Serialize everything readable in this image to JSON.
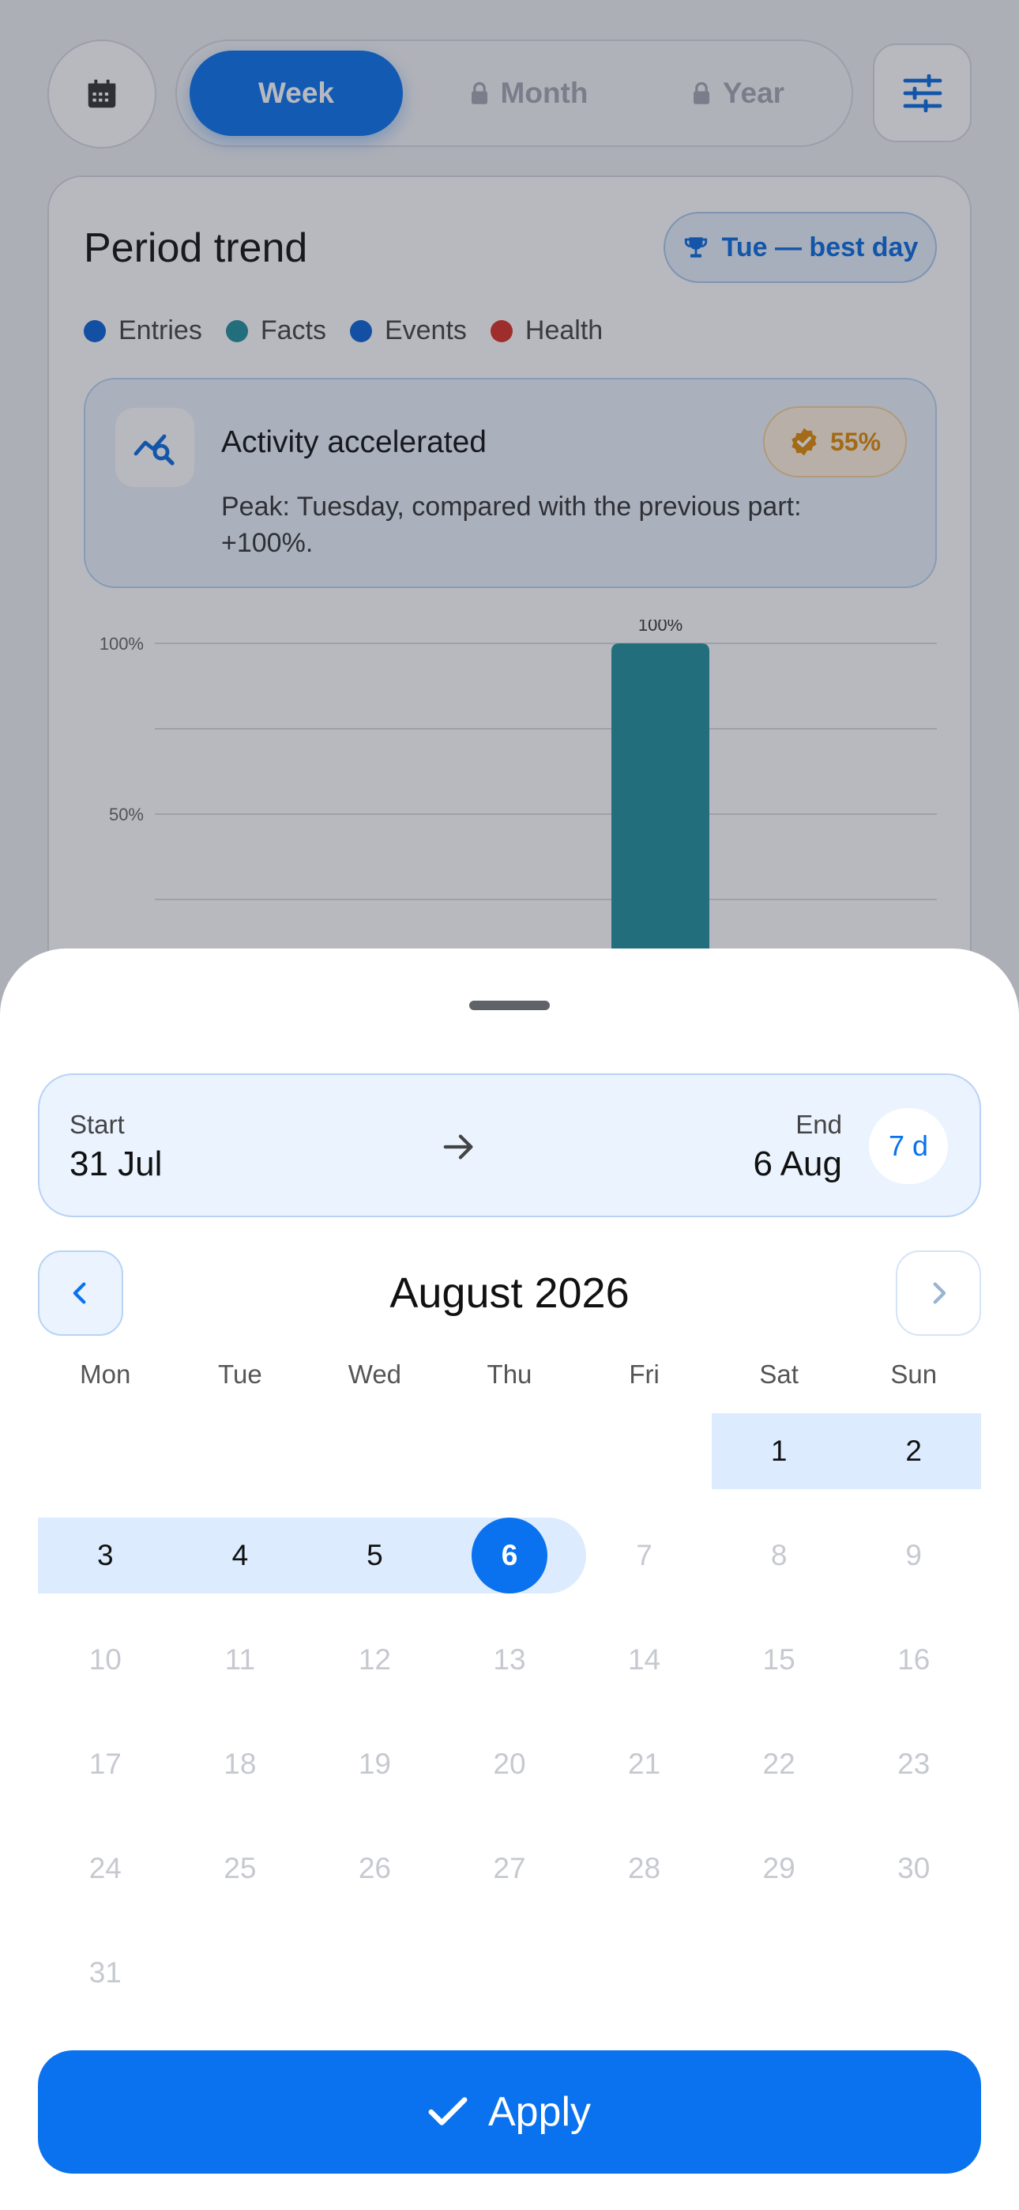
{
  "tabs": {
    "week": "Week",
    "month": "Month",
    "year": "Year",
    "active": "week"
  },
  "card": {
    "title": "Period trend",
    "best_day": "Tue — best day",
    "legend": [
      {
        "label": "Entries",
        "color": "#0a62d6"
      },
      {
        "label": "Facts",
        "color": "#22909f"
      },
      {
        "label": "Events",
        "color": "#0a62d6"
      },
      {
        "label": "Health",
        "color": "#d93025"
      }
    ],
    "insight": {
      "title": "Activity accelerated",
      "badge": "55%",
      "text": "Peak: Tuesday, compared with the previous part: +100%."
    }
  },
  "chart_data": {
    "type": "bar",
    "y_ticks": [
      "100%",
      "50%"
    ],
    "ylim": [
      0,
      100
    ],
    "bars": [
      {
        "value": 100,
        "label": "100%",
        "color": "#22909f"
      }
    ]
  },
  "sheet": {
    "range": {
      "start_label": "Start",
      "start_value": "31 Jul",
      "end_label": "End",
      "end_value": "6 Aug",
      "days": "7 d"
    },
    "month_title": "August 2026",
    "weekdays": [
      "Mon",
      "Tue",
      "Wed",
      "Thu",
      "Fri",
      "Sat",
      "Sun"
    ],
    "weeks": [
      [
        "",
        "",
        "",
        "",
        "",
        "1",
        "2"
      ],
      [
        "3",
        "4",
        "5",
        "6",
        "7",
        "8",
        "9"
      ],
      [
        "10",
        "11",
        "12",
        "13",
        "14",
        "15",
        "16"
      ],
      [
        "17",
        "18",
        "19",
        "20",
        "21",
        "22",
        "23"
      ],
      [
        "24",
        "25",
        "26",
        "27",
        "28",
        "29",
        "30"
      ],
      [
        "31",
        "",
        "",
        "",
        "",
        "",
        ""
      ]
    ],
    "apply_label": "Apply"
  },
  "colors": {
    "accent": "#0a72ee",
    "range_fill": "#dcebfd",
    "disabled_day": "#c6c9cf"
  }
}
